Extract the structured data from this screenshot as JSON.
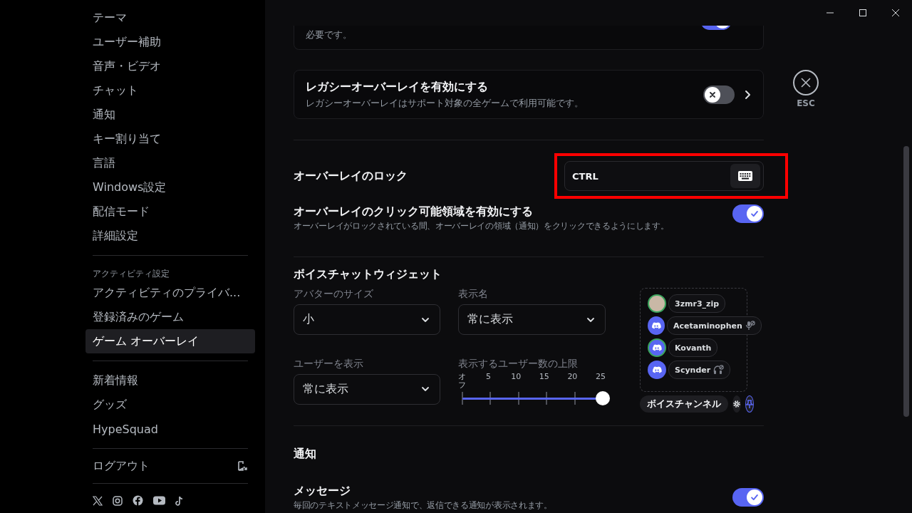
{
  "sidebar": {
    "groups": [
      {
        "items": [
          {
            "label": "テーマ",
            "selected": false
          },
          {
            "label": "ユーザー補助",
            "selected": false
          },
          {
            "label": "音声・ビデオ",
            "selected": false
          },
          {
            "label": "チャット",
            "selected": false
          },
          {
            "label": "通知",
            "selected": false
          },
          {
            "label": "キー割り当て",
            "selected": false
          },
          {
            "label": "言語",
            "selected": false
          },
          {
            "label": "Windows設定",
            "selected": false
          },
          {
            "label": "配信モード",
            "selected": false
          },
          {
            "label": "詳細設定",
            "selected": false
          }
        ]
      },
      {
        "header": "アクティビティ設定",
        "items": [
          {
            "label": "アクティビティのプライバ...",
            "selected": false
          },
          {
            "label": "登録済みのゲーム",
            "selected": false
          },
          {
            "label": "ゲーム オーバーレイ",
            "selected": true
          }
        ]
      },
      {
        "items": [
          {
            "label": "新着情報",
            "selected": false
          },
          {
            "label": "グッズ",
            "selected": false
          },
          {
            "label": "HypeSquad",
            "selected": false
          }
        ]
      }
    ],
    "logout": "ログアウト"
  },
  "top_card": {
    "description": "必要です。",
    "on": true
  },
  "legacy_overlay": {
    "title": "レガシーオーバーレイを有効にする",
    "description": "レガシーオーバーレイはサポート対象の全ゲームで利用可能です。",
    "on": false
  },
  "esc": {
    "label": "ESC"
  },
  "overlay_lock": {
    "label": "オーバーレイのロック",
    "keybind": "CTRL",
    "highlighted": true
  },
  "clickable_area": {
    "title": "オーバーレイのクリック可能領域を有効にする",
    "description": "オーバーレイがロックされている間、オーバーレイの領域（通知）をクリックできるようにします。",
    "on": true
  },
  "voice_widget": {
    "heading": "ボイスチャットウィジェット",
    "avatar_size": {
      "label": "アバターのサイズ",
      "value": "小"
    },
    "display_name": {
      "label": "表示名",
      "value": "常に表示"
    },
    "show_users": {
      "label": "ユーザーを表示",
      "value": "常に表示"
    },
    "user_limit": {
      "label": "表示するユーザー数の上限",
      "ticks": [
        "オフ",
        "5",
        "10",
        "15",
        "20",
        "25"
      ],
      "level": 1
    },
    "preview": {
      "users": [
        {
          "name": "3zmr3_zip",
          "kind": "photo",
          "speaking": true,
          "muted": false,
          "deafened": false
        },
        {
          "name": "Acetaminophen",
          "kind": "logo",
          "speaking": false,
          "muted": true,
          "deafened": false
        },
        {
          "name": "Kovanth",
          "kind": "logo",
          "speaking": true,
          "muted": false,
          "deafened": false
        },
        {
          "name": "Scynder",
          "kind": "logo",
          "speaking": false,
          "muted": false,
          "deafened": true
        }
      ],
      "channel_button": "ボイスチャンネル",
      "pin_selected": true
    }
  },
  "notifications": {
    "heading": "通知",
    "items": [
      {
        "title": "メッセージ",
        "description": "毎回のテキストメッセージ通知で、返信できる通知が表示されます。",
        "on": true
      }
    ]
  }
}
